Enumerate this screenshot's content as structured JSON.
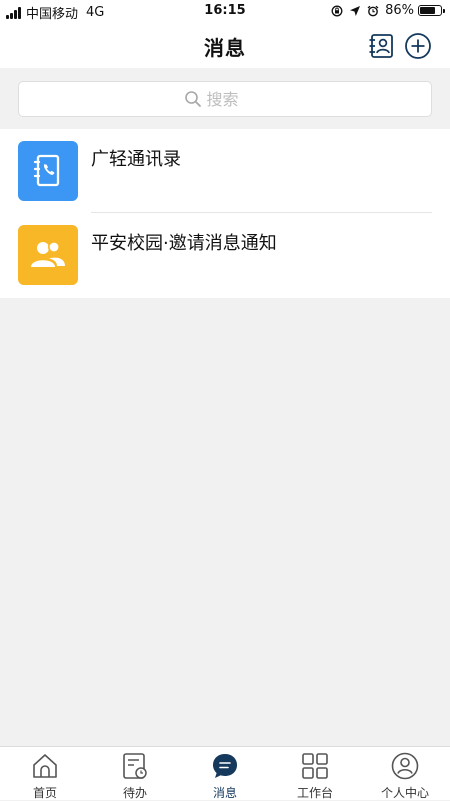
{
  "status_bar": {
    "carrier": "中国移动",
    "network": "4G",
    "time": "16:15",
    "battery_percent": "86%",
    "battery_level": 0.86
  },
  "header": {
    "title": "消息",
    "icons": [
      "contacts-book-icon",
      "add-circle-icon"
    ]
  },
  "search": {
    "placeholder": "搜索"
  },
  "conversations": [
    {
      "title": "广轻通讯录",
      "icon": "phone-book-icon",
      "icon_color": "#3b97f3"
    },
    {
      "title": "平安校园·邀请消息通知",
      "icon": "group-icon",
      "icon_color": "#f7b726"
    }
  ],
  "tabbar": {
    "active": "消息",
    "accent_color": "#14395c",
    "tabs": [
      {
        "label": "首页",
        "icon": "home-icon"
      },
      {
        "label": "待办",
        "icon": "todo-icon"
      },
      {
        "label": "消息",
        "icon": "message-icon"
      },
      {
        "label": "工作台",
        "icon": "grid-icon"
      },
      {
        "label": "个人中心",
        "icon": "profile-icon"
      }
    ]
  }
}
